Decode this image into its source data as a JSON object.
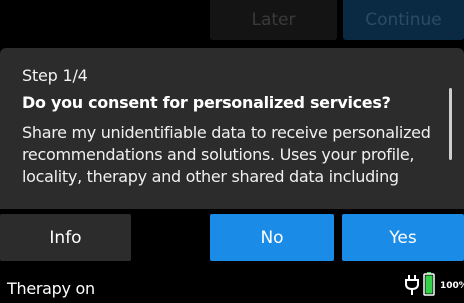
{
  "background": {
    "later_label": "Later",
    "continue_label": "Continue"
  },
  "dialog": {
    "step": "Step 1/4",
    "question": "Do you consent for personalized services?",
    "body": "Share my unidentifiable data to receive personalized recommendations and solutions. Uses your profile, locality, therapy and other shared data including"
  },
  "buttons": {
    "info": "Info",
    "no": "No",
    "yes": "Yes"
  },
  "status": {
    "therapy": "Therapy on",
    "battery_percent": "100%",
    "plug_icon": "plug-icon",
    "battery_icon": "battery-icon"
  },
  "colors": {
    "accent": "#1a8be6",
    "dialog_bg": "#2c2c2c",
    "battery_green": "#35d14a"
  }
}
